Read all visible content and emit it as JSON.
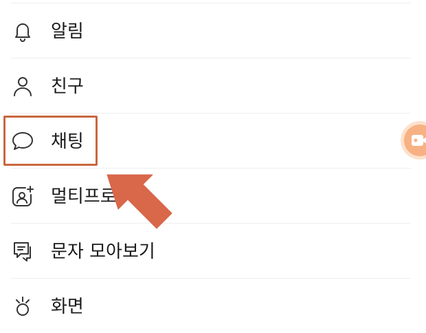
{
  "menu": {
    "items": [
      {
        "label": "알림",
        "icon": "bell-icon"
      },
      {
        "label": "친구",
        "icon": "person-icon"
      },
      {
        "label": "채팅",
        "icon": "chat-bubble-icon"
      },
      {
        "label": "멀티프로",
        "icon": "multi-profile-icon"
      },
      {
        "label": "문자 모아보기",
        "icon": "message-collection-icon"
      },
      {
        "label": "화면",
        "icon": "screen-icon"
      }
    ]
  },
  "annotation": {
    "highlight_color": "#c8673f",
    "arrow_color": "#d9674a"
  },
  "floating_button": {
    "icon": "video-camera-icon",
    "color": "#f7b183"
  }
}
